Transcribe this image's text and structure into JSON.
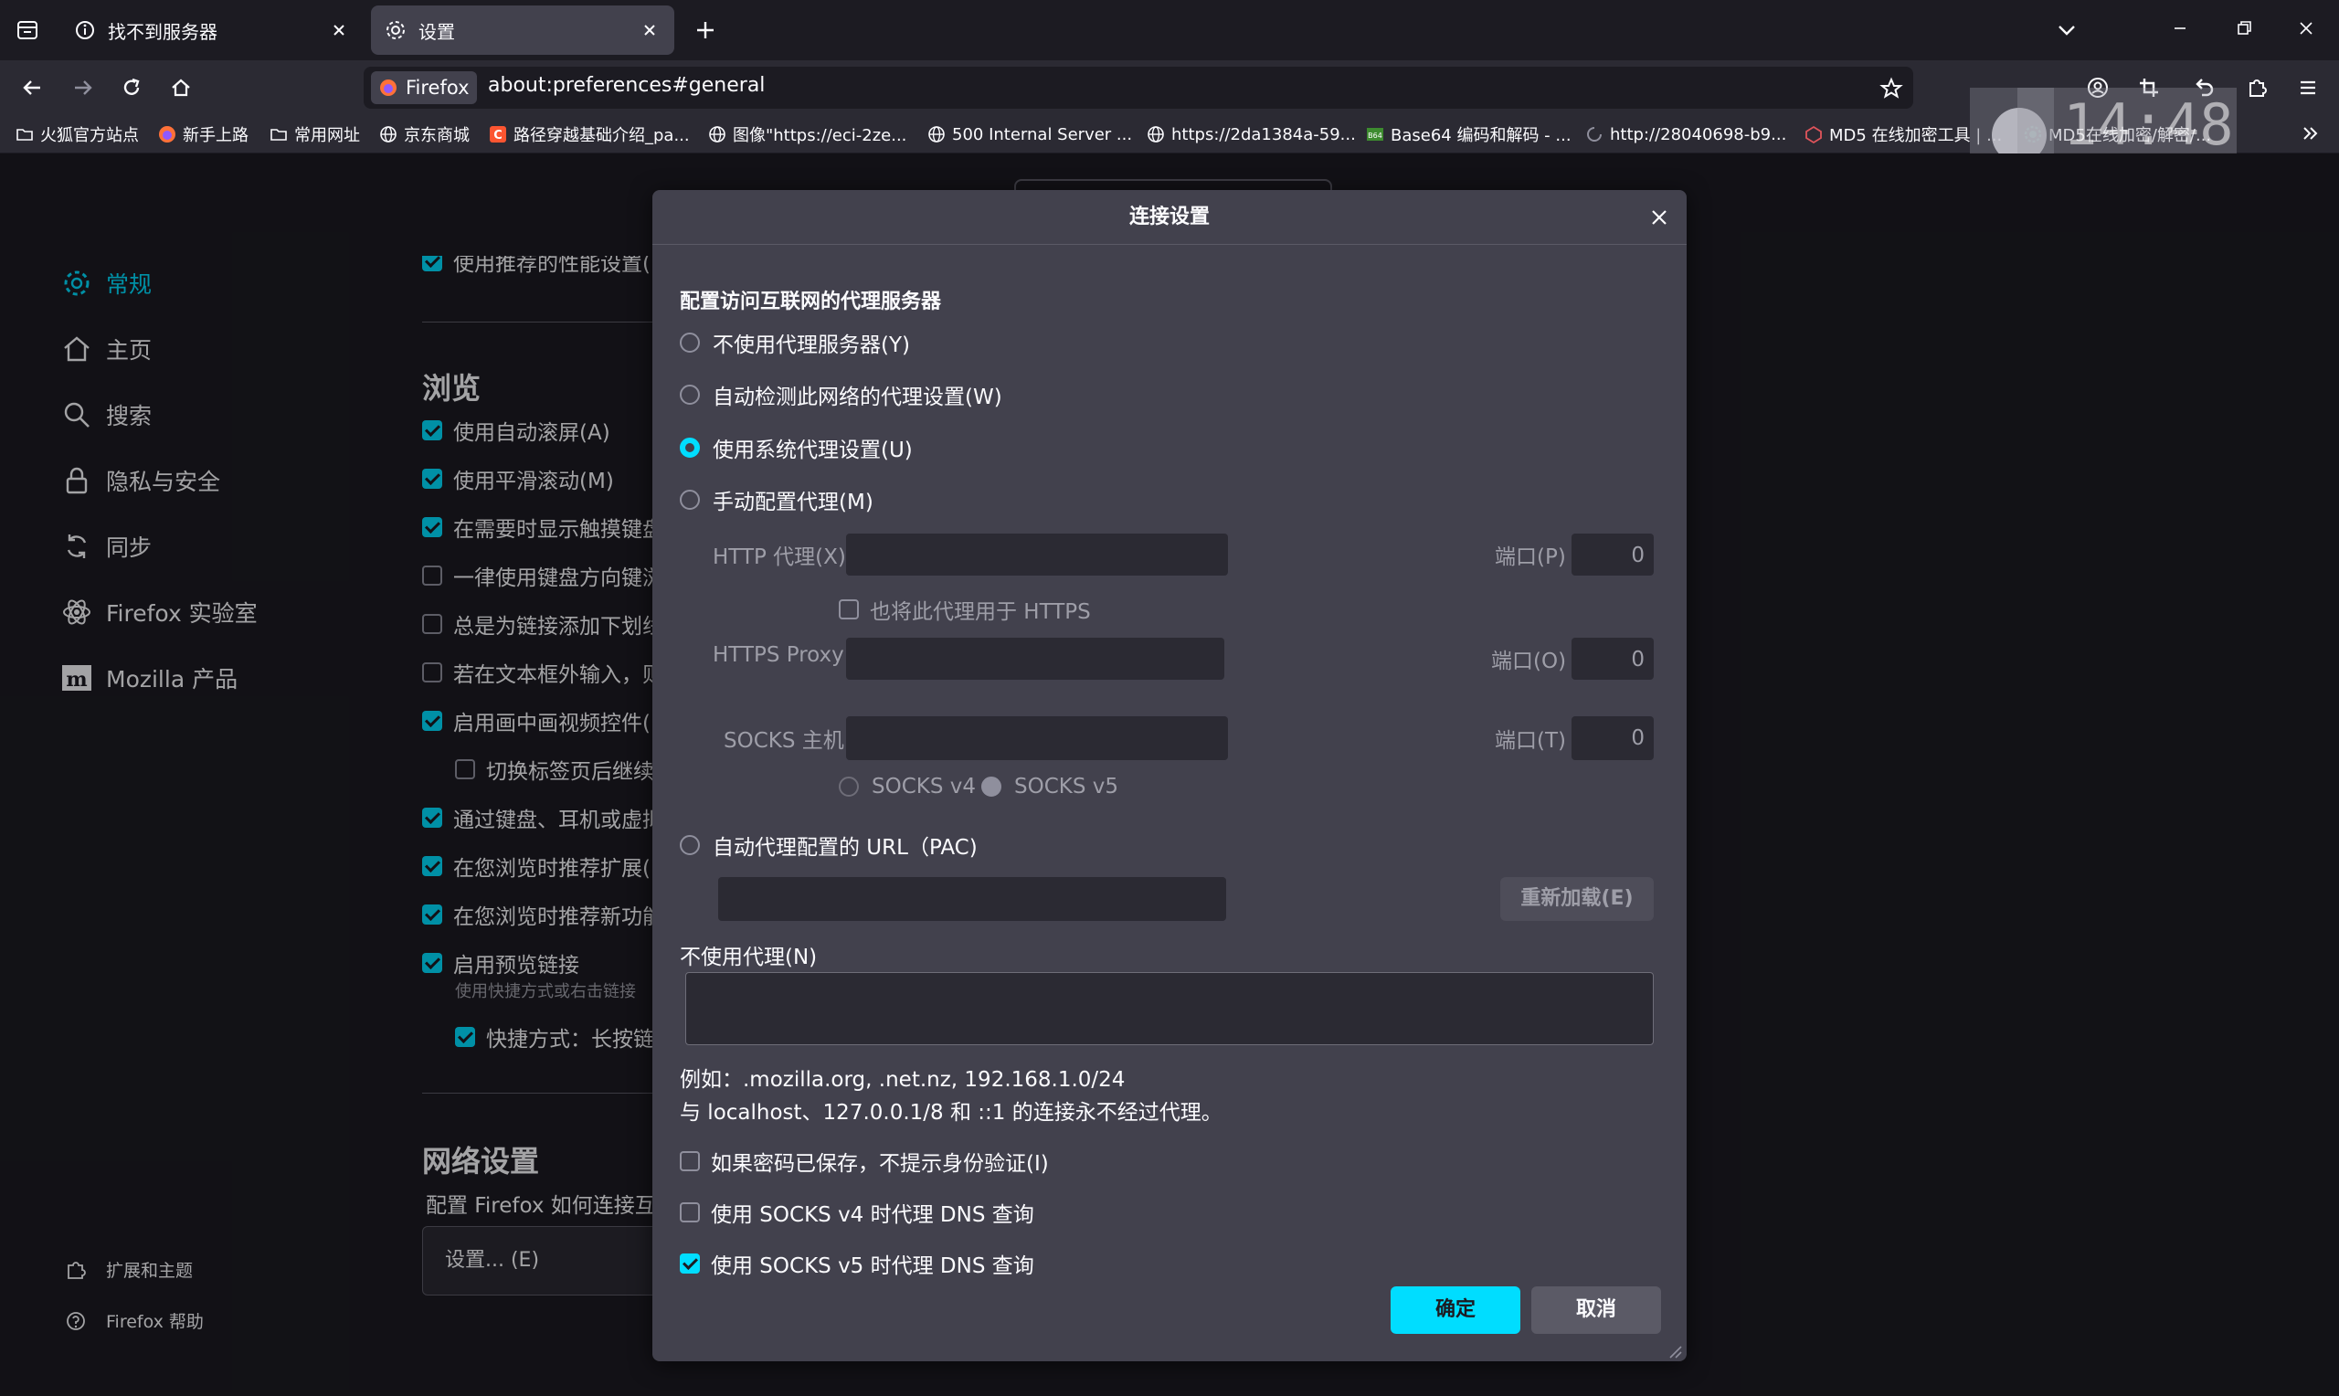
{
  "tabs": [
    {
      "label": "找不到服务器",
      "icon": "info-icon",
      "active": false
    },
    {
      "label": "设置",
      "icon": "gear-icon",
      "active": true
    }
  ],
  "urlbar": {
    "identity": "Firefox",
    "url": "about:preferences#general"
  },
  "bookmarks": [
    {
      "label": "火狐官方站点",
      "icon": "folder-icon"
    },
    {
      "label": "新手上路",
      "icon": "firefox-icon"
    },
    {
      "label": "常用网址",
      "icon": "folder-icon"
    },
    {
      "label": "京东商城",
      "icon": "globe-icon"
    },
    {
      "label": "路径穿越基础介绍_pa...",
      "icon": "csdn-icon"
    },
    {
      "label": "图像\"https://eci-2ze...",
      "icon": "globe-icon"
    },
    {
      "label": "500 Internal Server ...",
      "icon": "globe-icon"
    },
    {
      "label": "https://2da1384a-59...",
      "icon": "globe-icon"
    },
    {
      "label": "Base64 编码和解码 - ...",
      "icon": "base64-icon"
    },
    {
      "label": "http://28040698-b9...",
      "icon": "loading-icon"
    },
    {
      "label": "MD5 在线加密工具 | ...",
      "icon": "md5-icon"
    },
    {
      "label": "MD5在线加密/解密/...",
      "icon": "gear-green-icon"
    }
  ],
  "clock": "14:48",
  "sidebar": {
    "items": [
      {
        "label": "常规",
        "icon": "gear-icon",
        "selected": true
      },
      {
        "label": "主页",
        "icon": "home-icon"
      },
      {
        "label": "搜索",
        "icon": "search-icon"
      },
      {
        "label": "隐私与安全",
        "icon": "lock-icon"
      },
      {
        "label": "同步",
        "icon": "sync-icon"
      },
      {
        "label": "Firefox 实验室",
        "icon": "flask-icon"
      },
      {
        "label": "Mozilla 产品",
        "icon": "mozilla-icon"
      }
    ],
    "footer": [
      {
        "label": "扩展和主题",
        "icon": "puzzle-icon"
      },
      {
        "label": "Firefox 帮助",
        "icon": "help-icon"
      }
    ]
  },
  "prefs": {
    "top_partial": "使用推荐的性能设置(",
    "browsing_heading": "浏览",
    "rows": [
      {
        "label": "使用自动滚屏(A)",
        "checked": true
      },
      {
        "label": "使用平滑滚动(M)",
        "checked": true
      },
      {
        "label": "在需要时显示触摸键盘",
        "checked": true
      },
      {
        "label": "一律使用键盘方向键浏",
        "checked": false
      },
      {
        "label": "总是为链接添加下划线",
        "checked": false
      },
      {
        "label": "若在文本框外输入，则",
        "checked": false
      },
      {
        "label": "启用画中画视频控件(E",
        "checked": true
      },
      {
        "label": "切换标签页后继续",
        "checked": false,
        "indent": true
      },
      {
        "label": "通过键盘、耳机或虚拟",
        "checked": true
      },
      {
        "label": "在您浏览时推荐扩展(R",
        "checked": true
      },
      {
        "label": "在您浏览时推荐新功能",
        "checked": true
      },
      {
        "label": "启用预览链接",
        "checked": true
      },
      {
        "label": "快捷方式：长按链",
        "checked": true,
        "indent": true
      }
    ],
    "preview_hint": "使用快捷方式或右击链接",
    "network_heading": "网络设置",
    "network_desc": "配置 Firefox 如何连接互",
    "settings_button": "设置... (E)"
  },
  "dialog": {
    "title": "连接设置",
    "section_label": "配置访问互联网的代理服务器",
    "options": [
      {
        "label": "不使用代理服务器(Y)",
        "selected": false
      },
      {
        "label": "自动检测此网络的代理设置(W)",
        "selected": false
      },
      {
        "label": "使用系统代理设置(U)",
        "selected": true
      },
      {
        "label": "手动配置代理(M)",
        "selected": false
      }
    ],
    "http_label": "HTTP 代理(X)",
    "http_port_label": "端口(P)",
    "http_port": "0",
    "also_https": "也将此代理用于 HTTPS",
    "https_label": "HTTPS Proxy",
    "https_port_label": "端口(O)",
    "https_port": "0",
    "socks_label": "SOCKS 主机",
    "socks_port_label": "端口(T)",
    "socks_port": "0",
    "socks_v4": "SOCKS v4",
    "socks_v5": "SOCKS v5",
    "pac_label": "自动代理配置的 URL（PAC)",
    "reload_button": "重新加载(E)",
    "no_proxy_label": "不使用代理(N)",
    "example": "例如：.mozilla.org, .net.nz, 192.168.1.0/24",
    "localhost_note": "与 localhost、127.0.0.1/8 和 ::1 的连接永不经过代理。",
    "checks": [
      {
        "label": "如果密码已保存，不提示身份验证(I)",
        "checked": false
      },
      {
        "label": "使用 SOCKS v4 时代理 DNS 查询",
        "checked": false
      },
      {
        "label": "使用 SOCKS v5 时代理 DNS 查询",
        "checked": true
      }
    ],
    "ok_button": "确定",
    "cancel_button": "取消",
    "accent": "#00ddff"
  }
}
